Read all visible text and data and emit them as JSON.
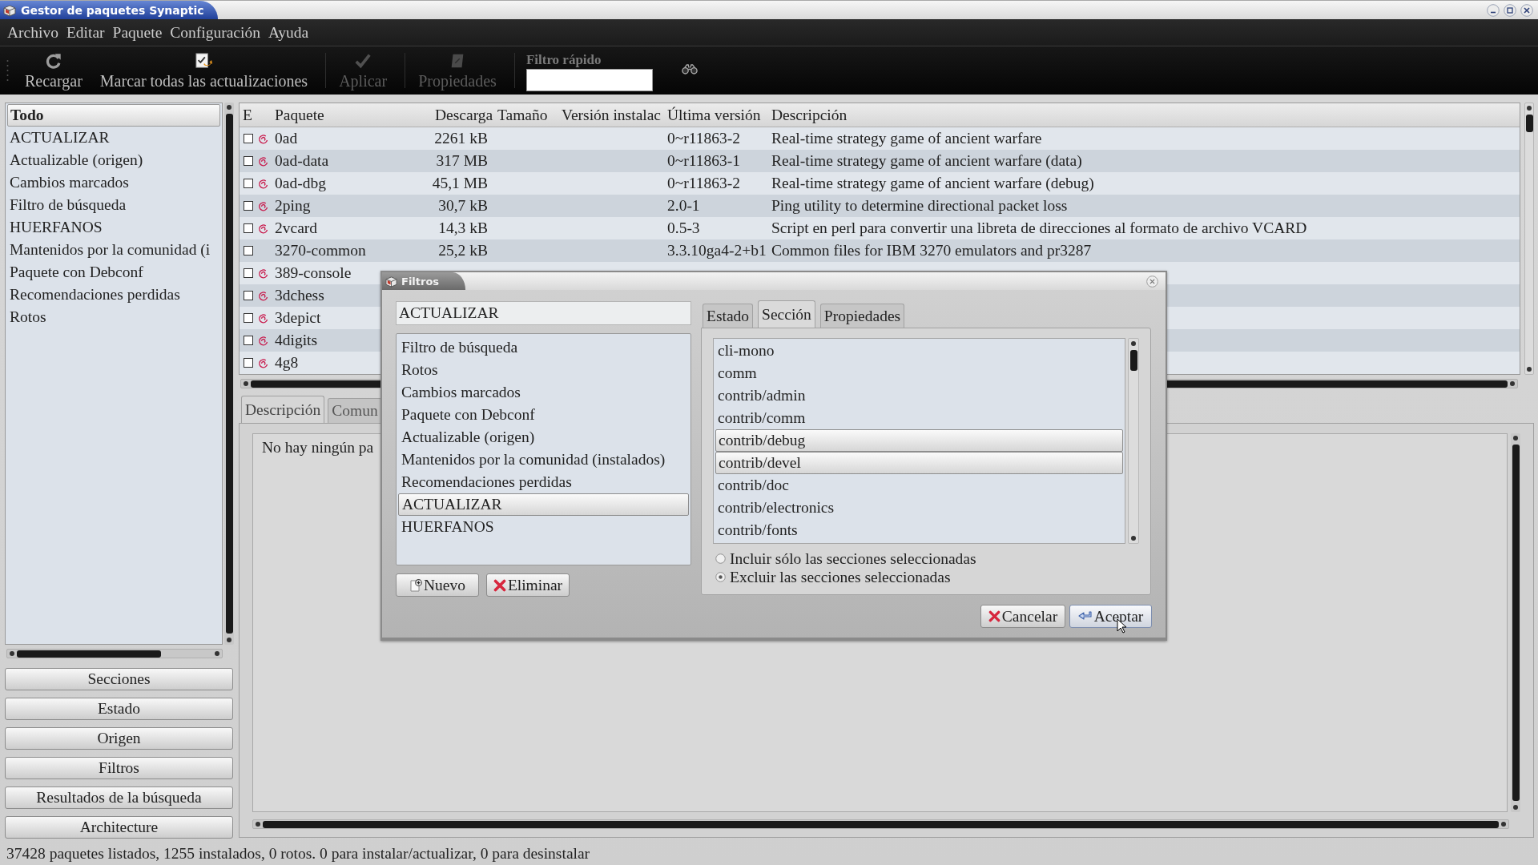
{
  "window": {
    "title": "Gestor de paquetes Synaptic"
  },
  "menu": [
    "Archivo",
    "Editar",
    "Paquete",
    "Configuración",
    "Ayuda"
  ],
  "toolbar": {
    "buttons": [
      {
        "label": "Recargar",
        "kind": "reload",
        "disabled": false
      },
      {
        "label": "Marcar todas las actualizaciones",
        "kind": "mark",
        "disabled": false
      },
      {
        "label": "Aplicar",
        "kind": "apply",
        "disabled": true
      },
      {
        "label": "Propiedades",
        "kind": "properties",
        "disabled": true
      }
    ],
    "quick_filter": {
      "label": "Filtro rápido"
    }
  },
  "sidebar": {
    "items": [
      {
        "label": "Todo",
        "selected": true
      },
      {
        "label": "ACTUALIZAR",
        "selected": false
      },
      {
        "label": "Actualizable (origen)",
        "selected": false
      },
      {
        "label": "Cambios marcados",
        "selected": false
      },
      {
        "label": "Filtro de búsqueda",
        "selected": false
      },
      {
        "label": "HUERFANOS",
        "selected": false
      },
      {
        "label": "Mantenidos por la comunidad (i",
        "selected": false
      },
      {
        "label": "Paquete con Debconf",
        "selected": false
      },
      {
        "label": "Recomendaciones perdidas",
        "selected": false
      },
      {
        "label": "Rotos",
        "selected": false
      }
    ],
    "buttons": [
      "Secciones",
      "Estado",
      "Origen",
      "Filtros",
      "Resultados de la búsqueda",
      "Architecture"
    ]
  },
  "packages": {
    "columns": [
      "E",
      "Paquete",
      "Descarga",
      "Tamaño",
      "Versión instalac",
      "Última versión",
      "Descripción"
    ],
    "rows": [
      {
        "checked": false,
        "supported": true,
        "name": "0ad",
        "download": "2261 kB",
        "latest_version": "0~r11863-2",
        "description": "Real-time strategy game of ancient warfare"
      },
      {
        "checked": false,
        "supported": true,
        "name": "0ad-data",
        "download": "317 MB",
        "latest_version": "0~r11863-1",
        "description": "Real-time strategy game of ancient warfare (data)"
      },
      {
        "checked": false,
        "supported": true,
        "name": "0ad-dbg",
        "download": "45,1 MB",
        "latest_version": "0~r11863-2",
        "description": "Real-time strategy game of ancient warfare (debug)"
      },
      {
        "checked": false,
        "supported": true,
        "name": "2ping",
        "download": "30,7 kB",
        "latest_version": "2.0-1",
        "description": "Ping utility to determine directional packet loss"
      },
      {
        "checked": false,
        "supported": true,
        "name": "2vcard",
        "download": "14,3 kB",
        "latest_version": "0.5-3",
        "description": "Script en perl para convertir una libreta de direcciones al formato de archivo VCARD"
      },
      {
        "checked": false,
        "supported": false,
        "name": "3270-common",
        "download": "25,2 kB",
        "latest_version": "3.3.10ga4-2+b1",
        "description": "Common files for IBM 3270 emulators and pr3287"
      },
      {
        "checked": false,
        "supported": true,
        "name": "389-console"
      },
      {
        "checked": false,
        "supported": true,
        "name": "3dchess"
      },
      {
        "checked": false,
        "supported": true,
        "name": "3depict"
      },
      {
        "checked": false,
        "supported": true,
        "name": "4digits"
      },
      {
        "checked": false,
        "supported": true,
        "name": "4g8"
      }
    ]
  },
  "details": {
    "tabs": [
      {
        "label": "Descripción",
        "selected": true
      },
      {
        "label": "Comun",
        "selected": false
      }
    ],
    "text": "No hay ningún pa"
  },
  "status_bar": "37428 paquetes listados, 1255 instalados, 0 rotos. 0 para instalar/actualizar, 0 para desinstalar",
  "filter_dialog": {
    "title": "Filtros",
    "name_field": {
      "value": "ACTUALIZAR"
    },
    "filters": [
      {
        "label": "Filtro de búsqueda",
        "selected": false
      },
      {
        "label": "Rotos",
        "selected": false
      },
      {
        "label": "Cambios marcados",
        "selected": false
      },
      {
        "label": "Paquete con Debconf",
        "selected": false
      },
      {
        "label": "Actualizable (origen)",
        "selected": false
      },
      {
        "label": "Mantenidos por la comunidad (instalados)",
        "selected": false
      },
      {
        "label": "Recomendaciones perdidas",
        "selected": false
      },
      {
        "label": "ACTUALIZAR",
        "selected": true
      },
      {
        "label": "HUERFANOS",
        "selected": false
      }
    ],
    "list_buttons": [
      {
        "label": "Nuevo",
        "kind": "new"
      },
      {
        "label": "Eliminar",
        "kind": "delete"
      }
    ],
    "tabs": [
      {
        "label": "Estado",
        "selected": false
      },
      {
        "label": "Sección",
        "selected": true
      },
      {
        "label": "Propiedades",
        "selected": false
      }
    ],
    "sections": [
      {
        "label": "cli-mono",
        "selected": false
      },
      {
        "label": "comm",
        "selected": false
      },
      {
        "label": "contrib/admin",
        "selected": false
      },
      {
        "label": "contrib/comm",
        "selected": false
      },
      {
        "label": "contrib/debug",
        "selected": true
      },
      {
        "label": "contrib/devel",
        "selected": true
      },
      {
        "label": "contrib/doc",
        "selected": false
      },
      {
        "label": "contrib/electronics",
        "selected": false
      },
      {
        "label": "contrib/fonts",
        "selected": false
      }
    ],
    "options": [
      {
        "label": "Incluir sólo las secciones seleccionadas",
        "selected": false
      },
      {
        "label": "Excluir las secciones seleccionadas",
        "selected": true
      }
    ],
    "buttons": [
      {
        "label": "Cancelar",
        "kind": "cancel"
      },
      {
        "label": "Aceptar",
        "kind": "ok"
      }
    ]
  }
}
